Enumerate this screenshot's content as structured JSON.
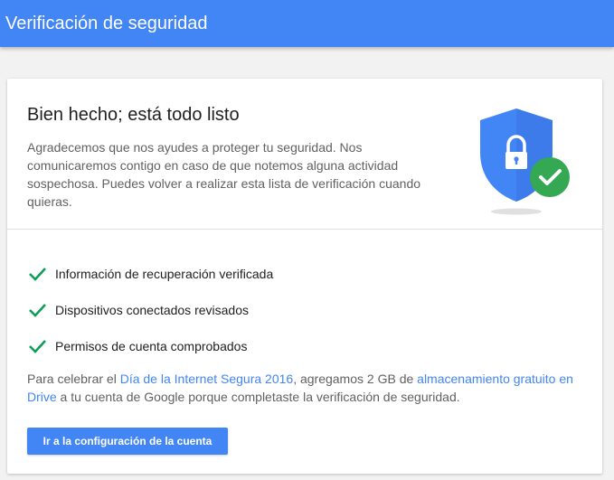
{
  "appbar": {
    "title": "Verificación de seguridad"
  },
  "card": {
    "title": "Bien hecho; está todo listo",
    "description": "Agradecemos que nos ayudes a proteger tu seguridad. Nos comunicaremos contigo en caso de que notemos alguna actividad sospechosa. Puedes volver a realizar esta lista de verificación cuando quieras.",
    "illustration_icon": "shield-lock-check-icon",
    "checklist": [
      {
        "icon": "check-icon",
        "label": "Información de recuperación verificada"
      },
      {
        "icon": "check-icon",
        "label": "Dispositivos conectados revisados"
      },
      {
        "icon": "check-icon",
        "label": "Permisos de cuenta comprobados"
      }
    ],
    "promo": {
      "prefix": "Para celebrar el ",
      "link1": "Día de la Internet Segura 2016",
      "middle": ", agregamos 2 GB de ",
      "link2": "almacenamiento gratuito en Drive",
      "suffix": " a tu cuenta de Google porque completaste la verificación de seguridad."
    },
    "button_label": "Ir a la configuración de la cuenta"
  },
  "colors": {
    "primary": "#4285f4",
    "shield": "#4285f4",
    "success": "#34a853",
    "check": "#0f9d58"
  }
}
